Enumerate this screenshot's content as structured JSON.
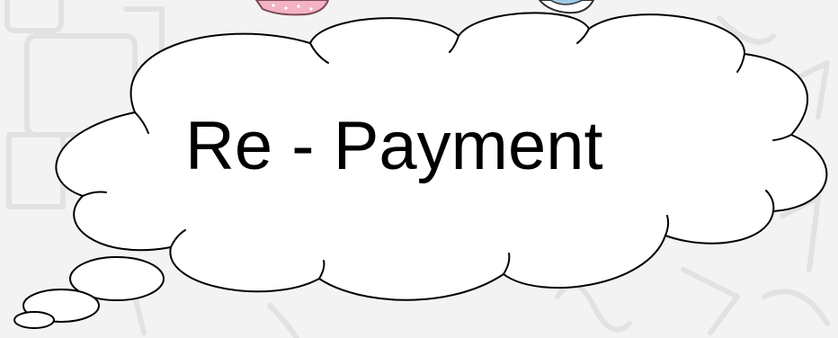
{
  "bubble": {
    "text": "Re - Payment"
  },
  "colors": {
    "background": "#f3f3f3",
    "cloud_fill": "#ffffff",
    "cloud_stroke": "#000000",
    "doodle_faint": "#e6e6e6",
    "pink_cartoon": "#f3b2c6",
    "blue_cartoon": "#9ec9e6"
  },
  "icons": {
    "thought_bubble": "thought-cloud-icon",
    "pink_cartoon": "pink-cartoon-fragment",
    "blue_cartoon": "blue-cartoon-fragment"
  }
}
